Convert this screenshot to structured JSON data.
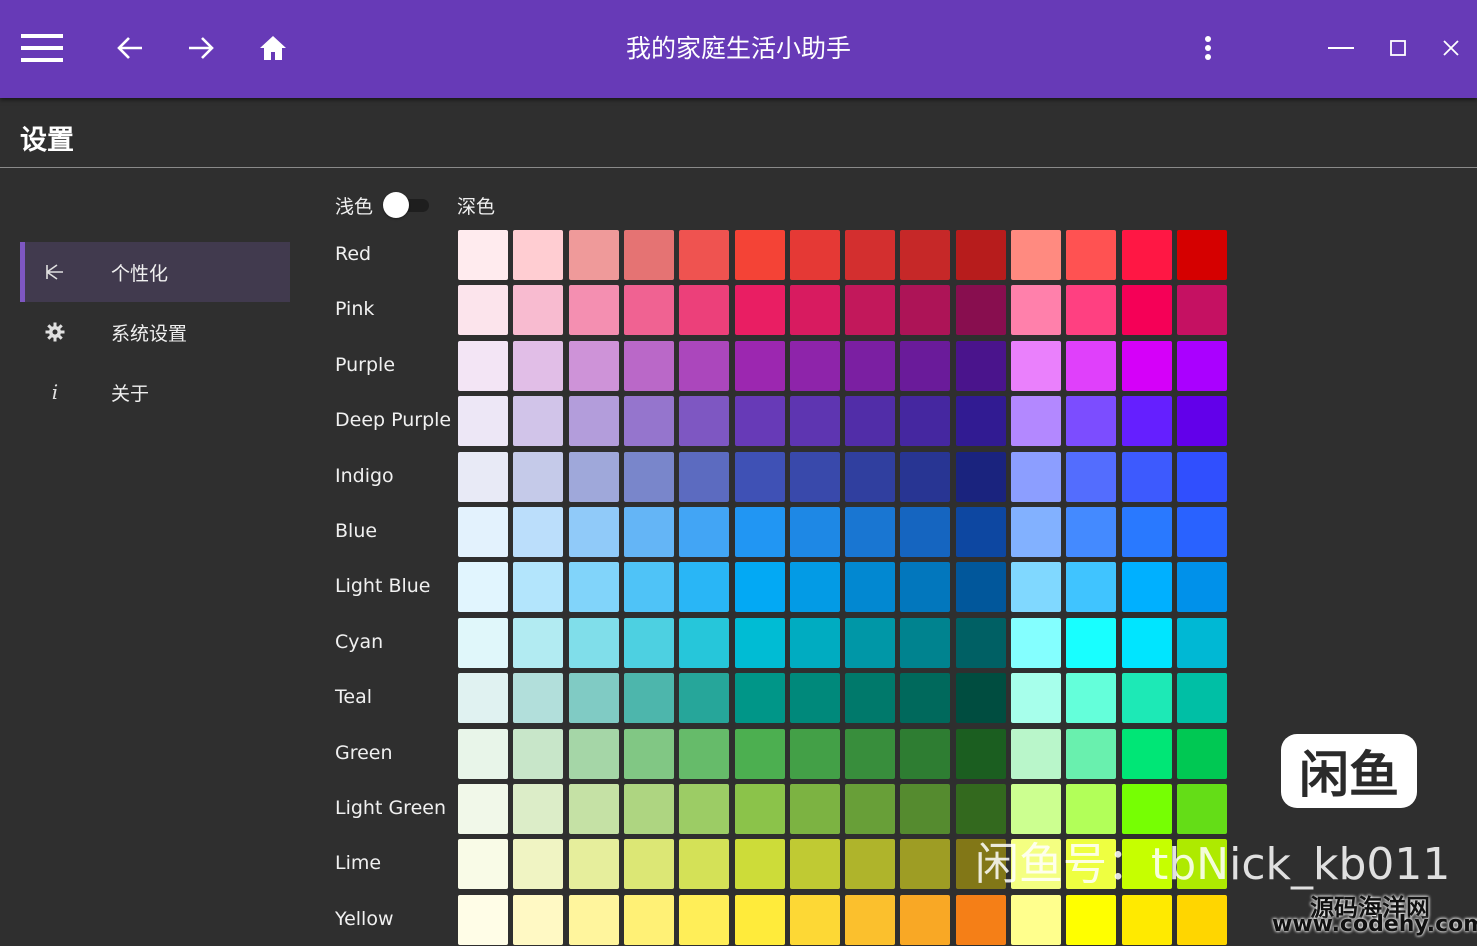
{
  "app": {
    "title": "我的家庭生活小助手"
  },
  "titlebar": {
    "buttons": [
      {
        "icon": "menu-icon"
      },
      {
        "icon": "arrow-left-icon"
      },
      {
        "icon": "arrow-right-icon"
      },
      {
        "icon": "home-icon"
      },
      {
        "icon": "more-vertical-icon"
      },
      {
        "icon": "minimize-icon"
      },
      {
        "icon": "maximize-icon"
      },
      {
        "icon": "close-icon"
      }
    ],
    "color": "#673ab7"
  },
  "page": {
    "title": "设置"
  },
  "nav": {
    "items": [
      {
        "label": "个性化",
        "icon": "palette-icon",
        "active": true
      },
      {
        "label": "系统设置",
        "icon": "gear-icon",
        "active": false
      },
      {
        "label": "关于",
        "icon": "info-icon",
        "active": false
      }
    ],
    "active_color": "#7e57c2"
  },
  "theme": {
    "light_label": "浅色",
    "dark_label": "深色",
    "dark_selected": false
  },
  "palette": {
    "rows": [
      {
        "name": "Red",
        "colors": [
          "#ffebee",
          "#ffcdd2",
          "#ef9a9a",
          "#e57373",
          "#ef5350",
          "#f44336",
          "#e53935",
          "#d32f2f",
          "#c62828",
          "#b71c1c",
          "#ff8a80",
          "#ff5252",
          "#ff1744",
          "#d50000"
        ]
      },
      {
        "name": "Pink",
        "colors": [
          "#fce4ec",
          "#f8bbd0",
          "#f48fb1",
          "#f06292",
          "#ec407a",
          "#e91e63",
          "#d81b60",
          "#c2185b",
          "#ad1457",
          "#880e4f",
          "#ff80ab",
          "#ff4081",
          "#f50057",
          "#c51162"
        ]
      },
      {
        "name": "Purple",
        "colors": [
          "#f3e5f5",
          "#e1bee7",
          "#ce93d8",
          "#ba68c8",
          "#ab47bc",
          "#9c27b0",
          "#8e24aa",
          "#7b1fa2",
          "#6a1b9a",
          "#4a148c",
          "#ea80fc",
          "#e040fb",
          "#d500f9",
          "#aa00ff"
        ]
      },
      {
        "name": "Deep Purple",
        "colors": [
          "#ede7f6",
          "#d1c4e9",
          "#b39ddb",
          "#9575cd",
          "#7e57c2",
          "#673ab7",
          "#5e35b1",
          "#512da8",
          "#4527a0",
          "#311b92",
          "#b388ff",
          "#7c4dff",
          "#651fff",
          "#6200ea"
        ]
      },
      {
        "name": "Indigo",
        "colors": [
          "#e8eaf6",
          "#c5cae9",
          "#9fa8da",
          "#7986cb",
          "#5c6bc0",
          "#3f51b5",
          "#3949ab",
          "#303f9f",
          "#283593",
          "#1a237e",
          "#8c9eff",
          "#536dfe",
          "#3d5afe",
          "#304ffe"
        ]
      },
      {
        "name": "Blue",
        "colors": [
          "#e3f2fd",
          "#bbdefb",
          "#90caf9",
          "#64b5f6",
          "#42a5f5",
          "#2196f3",
          "#1e88e5",
          "#1976d2",
          "#1565c0",
          "#0d47a1",
          "#82b1ff",
          "#448aff",
          "#2979ff",
          "#2962ff"
        ]
      },
      {
        "name": "Light Blue",
        "colors": [
          "#e1f5fe",
          "#b3e5fc",
          "#81d4fa",
          "#4fc3f7",
          "#29b6f6",
          "#03a9f4",
          "#039be5",
          "#0288d1",
          "#0277bd",
          "#01579b",
          "#80d8ff",
          "#40c4ff",
          "#00b0ff",
          "#0091ea"
        ]
      },
      {
        "name": "Cyan",
        "colors": [
          "#e0f7fa",
          "#b2ebf2",
          "#80deea",
          "#4dd0e1",
          "#26c6da",
          "#00bcd4",
          "#00acc1",
          "#0097a7",
          "#00838f",
          "#006064",
          "#84ffff",
          "#18ffff",
          "#00e5ff",
          "#00b8d4"
        ]
      },
      {
        "name": "Teal",
        "colors": [
          "#e0f2f1",
          "#b2dfdb",
          "#80cbc4",
          "#4db6ac",
          "#26a69a",
          "#009688",
          "#00897b",
          "#00796b",
          "#00695c",
          "#004d40",
          "#a7ffeb",
          "#64ffda",
          "#1de9b6",
          "#00bfa5"
        ]
      },
      {
        "name": "Green",
        "colors": [
          "#e8f5e9",
          "#c8e6c9",
          "#a5d6a7",
          "#81c784",
          "#66bb6a",
          "#4caf50",
          "#43a047",
          "#388e3c",
          "#2e7d32",
          "#1b5e20",
          "#b9f6ca",
          "#69f0ae",
          "#00e676",
          "#00c853"
        ]
      },
      {
        "name": "Light Green",
        "colors": [
          "#f1f8e9",
          "#dcedc8",
          "#c5e1a5",
          "#aed581",
          "#9ccc65",
          "#8bc34a",
          "#7cb342",
          "#689f38",
          "#558b2f",
          "#33691e",
          "#ccff90",
          "#b2ff59",
          "#76ff03",
          "#64dd17"
        ]
      },
      {
        "name": "Lime",
        "colors": [
          "#f9fbe7",
          "#f0f4c3",
          "#e6ee9c",
          "#dce775",
          "#d4e157",
          "#cddc39",
          "#c0ca33",
          "#afb42b",
          "#9e9d24",
          "#827717",
          "#f4ff81",
          "#eeff41",
          "#c6ff00",
          "#aeea00"
        ]
      },
      {
        "name": "Yellow",
        "colors": [
          "#fffde7",
          "#fff9c4",
          "#fff59d",
          "#fff176",
          "#ffee58",
          "#ffeb3b",
          "#fdd835",
          "#fbc02d",
          "#f9a825",
          "#f57f17",
          "#ffff8d",
          "#ffff00",
          "#ffea00",
          "#ffd600"
        ]
      }
    ]
  },
  "watermark": {
    "badge": "闲鱼",
    "id_text": "闲鱼号：tbNick_kb011",
    "site_cn": "源码海洋网",
    "site_url": "www.codehy.com"
  }
}
